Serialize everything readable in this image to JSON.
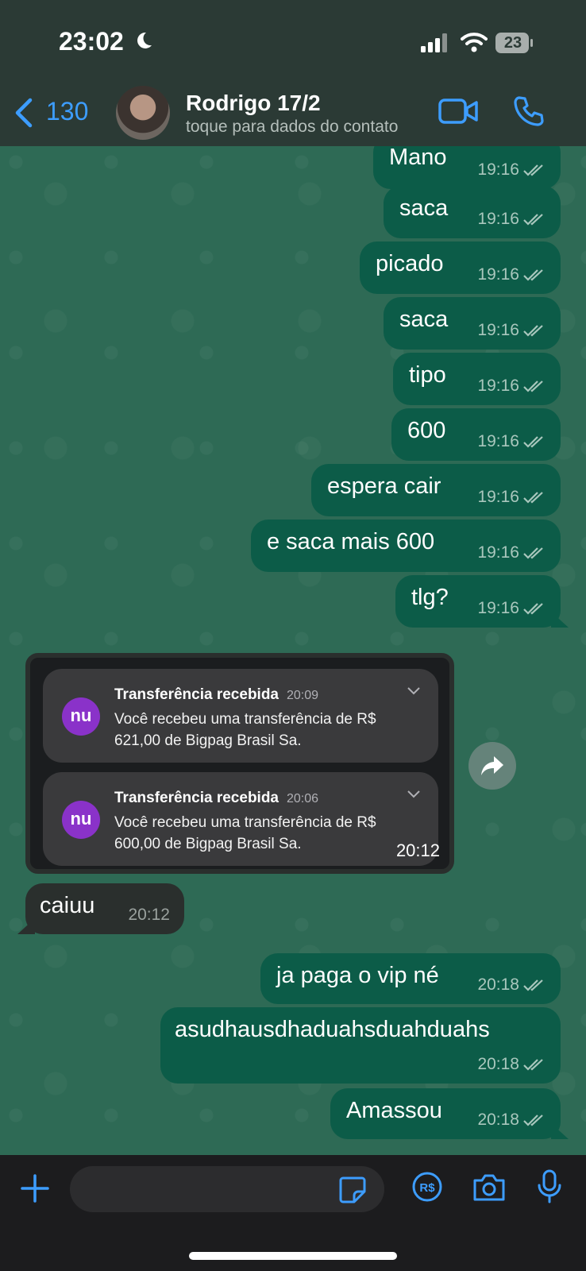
{
  "status_bar": {
    "time": "23:02",
    "battery": "23"
  },
  "header": {
    "back_count": "130",
    "contact_name": "Rodrigo 17/2",
    "contact_subtitle": "toque para dados do contato"
  },
  "messages": [
    {
      "text": "Mano",
      "time": "19:16"
    },
    {
      "text": "saca",
      "time": "19:16"
    },
    {
      "text": "picado",
      "time": "19:16"
    },
    {
      "text": "saca",
      "time": "19:16"
    },
    {
      "text": "tipo",
      "time": "19:16"
    },
    {
      "text": "600",
      "time": "19:16"
    },
    {
      "text": "espera cair",
      "time": "19:16"
    },
    {
      "text": "e saca mais 600",
      "time": "19:16"
    },
    {
      "text": "tlg?",
      "time": "19:16"
    }
  ],
  "image_message": {
    "time": "20:12",
    "notifications": [
      {
        "title": "Transferência recebida",
        "time": "20:09",
        "body": "Você recebeu uma transferência de R$ 621,00 de Bigpag Brasil Sa.",
        "logo": "nu"
      },
      {
        "title": "Transferência recebida",
        "time": "20:06",
        "body": "Você recebeu uma transferência de R$ 600,00 de Bigpag Brasil Sa.",
        "logo": "nu"
      }
    ]
  },
  "incoming": {
    "text": "caiuu",
    "time": "20:12"
  },
  "messages2": [
    {
      "text": "ja paga o vip né",
      "time": "20:18"
    },
    {
      "text": "asudhausdhaduahsduahduahs",
      "time": "20:18"
    },
    {
      "text": "Amassou",
      "time": "20:18"
    }
  ],
  "colors": {
    "accent": "#3d9dff",
    "outgoing_bubble": "#0c5c48",
    "incoming_bubble": "#2a2f2d",
    "chat_background": "#2e6a55"
  }
}
